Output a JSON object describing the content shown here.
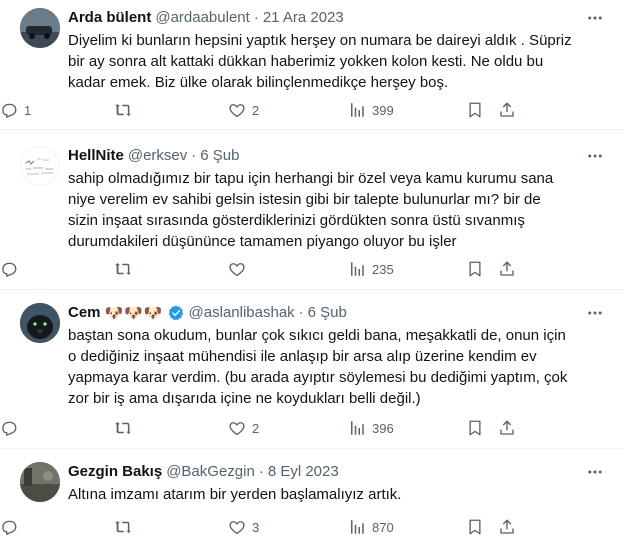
{
  "tweets": [
    {
      "name": "Arda bülent",
      "handle": "@ardaabulent",
      "time": "21 Ara 2023",
      "emoji": "",
      "verified": false,
      "text": "Diyelim ki bunların hepsini yaptık herşey on numara be daireyi aldık . Süpriz\nbir ay sonra alt kattaki dükkan haberimiz yokken kolon kesti. Ne oldu bu\nkadar emek. Biz ülke olarak bilinçlenmedikçe herşey boş.",
      "replies": "1",
      "retweets": "",
      "likes": "2",
      "views": "399"
    },
    {
      "name": "HellNite",
      "handle": "@erksev",
      "time": "6 Şub",
      "emoji": "",
      "verified": false,
      "text": "sahip olmadığımız bir tapu için herhangi bir özel veya kamu kurumu sana\nniye verelim ev sahibi gelsin istesin gibi bir talepte bulunurlar mı? bir de\nsizin inşaat sırasında gösterdiklerinizi gördükten sonra üstü sıvanmış\ndurumdakileri düşününce tamamen piyango oluyor bu işler",
      "replies": "",
      "retweets": "",
      "likes": "",
      "views": "235"
    },
    {
      "name": "Cem",
      "handle": "@aslanlibashak",
      "time": "6 Şub",
      "emoji": "🐶🐶🐶",
      "verified": true,
      "text": "baştan sona okudum, bunlar çok sıkıcı geldi bana, meşakkatli de, onun için\no dediğiniz inşaat mühendisi ile anlaşıp bir arsa alıp üzerine kendim ev\nyapmaya karar verdim. (bu arada ayıptır söylemesi bu dediğimi yaptım, çok\nzor bir iş ama dışarıda içine ne koydukları belli değil.)",
      "replies": "",
      "retweets": "",
      "likes": "2",
      "views": "396"
    },
    {
      "name": "Gezgin Bakış",
      "handle": "@BakGezgin",
      "time": "8 Eyl 2023",
      "emoji": "",
      "verified": false,
      "text": "Altına imzamı atarım bir yerden başlamalıyız artık.",
      "replies": "",
      "retweets": "",
      "likes": "3",
      "views": "870"
    }
  ],
  "icons": {
    "reply": "reply-icon",
    "retweet": "retweet-icon",
    "like": "heart-icon",
    "views": "views-chart-icon",
    "bookmark": "bookmark-icon",
    "share": "share-icon",
    "more": "more-dots-icon",
    "verified": "verified-badge-icon"
  },
  "colors": {
    "text": "#0f1419",
    "secondary": "#536471",
    "verified": "#1d9bf0",
    "divider": "#eff3f4"
  }
}
